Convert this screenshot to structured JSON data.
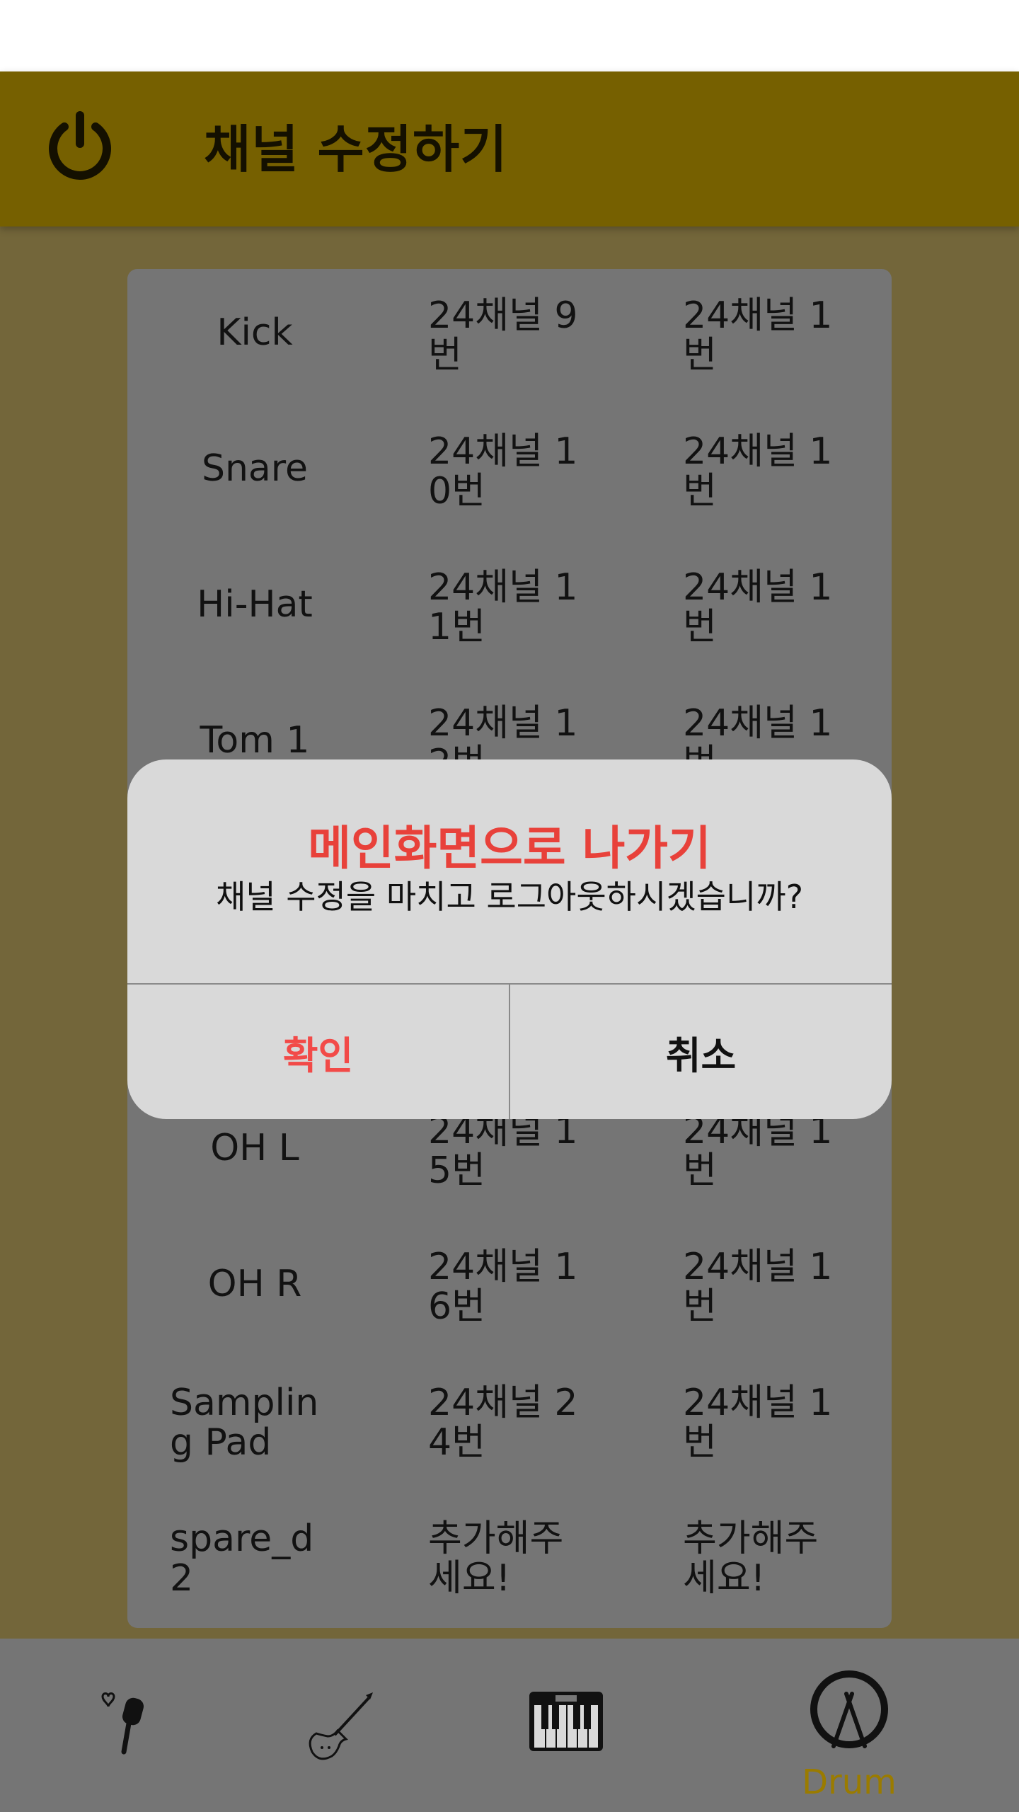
{
  "header": {
    "title": "채널 수정하기"
  },
  "table": {
    "rows": [
      {
        "name": "Kick",
        "channel": "24채널 9번",
        "sub": "24채널 1번",
        "center": true
      },
      {
        "name": "Snare",
        "channel": "24채널 10번",
        "sub": "24채널 1번",
        "center": true
      },
      {
        "name": "Hi-Hat",
        "channel": "24채널 11번",
        "sub": "24채널 1번",
        "center": true
      },
      {
        "name": "Tom 1",
        "channel": "24채널 12번",
        "sub": "24채널 1번",
        "center": true
      },
      {
        "name": "OH L",
        "channel": "24채널 15번",
        "sub": "24채널 1번",
        "center": true
      },
      {
        "name": "OH R",
        "channel": "24채널 16번",
        "sub": "24채널 1번",
        "center": true
      },
      {
        "name": "Sampling Pad",
        "channel": "24채널 24번",
        "sub": "24채널 1번",
        "center": false
      },
      {
        "name": "spare_d2",
        "channel": "추가해주세요!",
        "sub": "추가해주세요!",
        "center": false
      }
    ]
  },
  "dialog": {
    "title": "메인화면으로 나가기",
    "message": "채널 수정을 마치고 로그아웃하시겠습니까?",
    "confirm": "확인",
    "cancel": "취소"
  },
  "bottom_nav": {
    "items": [
      {
        "icon": "microphone-icon",
        "label": ""
      },
      {
        "icon": "guitar-icon",
        "label": ""
      },
      {
        "icon": "piano-icon",
        "label": ""
      },
      {
        "icon": "drum-icon",
        "label": "Drum"
      }
    ]
  },
  "colors": {
    "header": "#766000",
    "accent": "#9a7b00",
    "danger": "#e8413a"
  }
}
